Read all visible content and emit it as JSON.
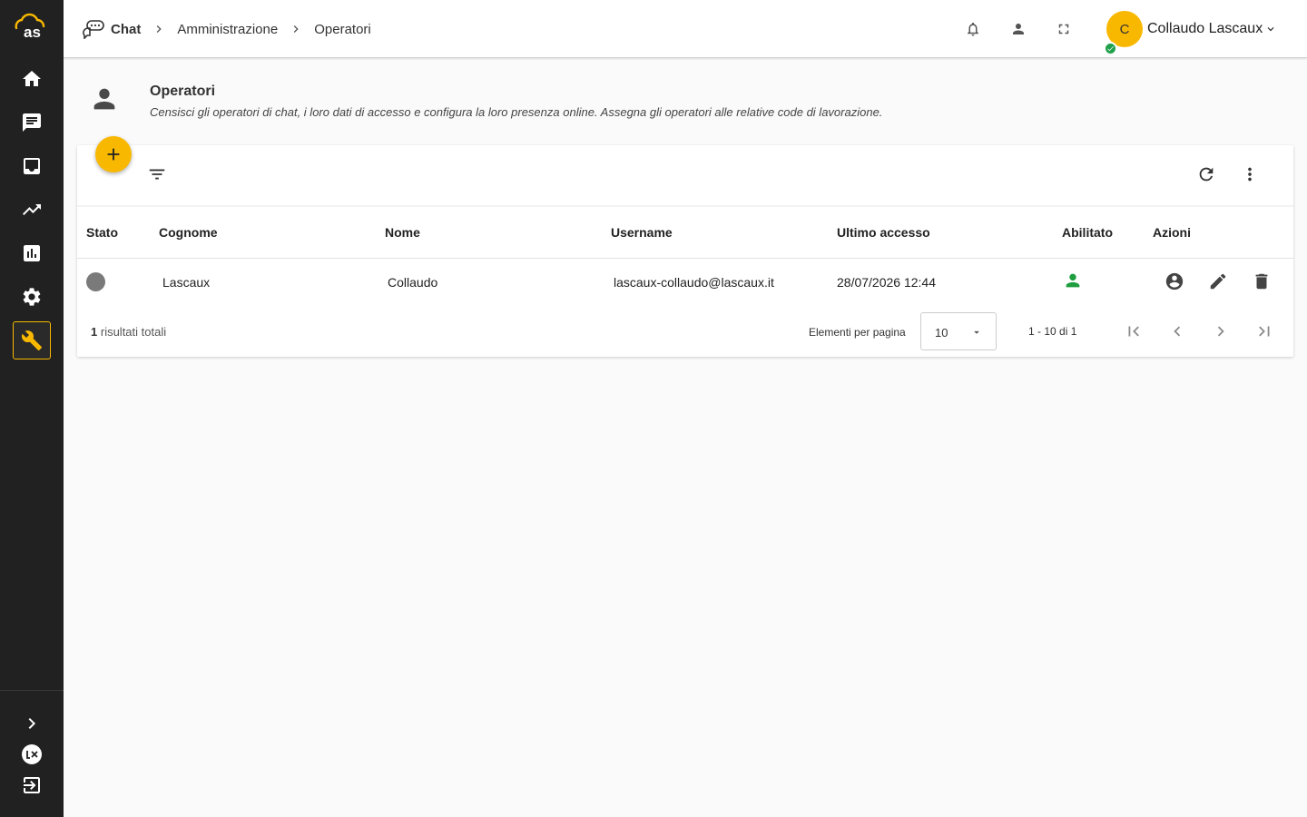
{
  "sidebar": {
    "logo_text": "as",
    "items": [
      {
        "name": "home",
        "icon": "home-icon"
      },
      {
        "name": "chat",
        "icon": "chat-icon"
      },
      {
        "name": "inbox",
        "icon": "inbox-icon"
      },
      {
        "name": "trending",
        "icon": "trending-up-icon"
      },
      {
        "name": "reports",
        "icon": "bar-chart-icon"
      },
      {
        "name": "settings",
        "icon": "gear-icon"
      },
      {
        "name": "admin",
        "icon": "wrench-icon",
        "active": true
      }
    ],
    "bottom": [
      "expand-icon",
      "lx-brand-icon",
      "logout-icon"
    ]
  },
  "header": {
    "breadcrumb": [
      "Chat",
      "Amministrazione",
      "Operatori"
    ],
    "icons": [
      "bell-icon",
      "person-icon",
      "fullscreen-icon"
    ],
    "user": {
      "initial": "C",
      "name": "Collaudo Lascaux",
      "status_color": "#21a04b"
    }
  },
  "page": {
    "title": "Operatori",
    "description": "Censisci gli operatori di chat, i loro dati di accesso e configura la loro presenza online. Assegna gli operatori alle relative code di lavorazione."
  },
  "table": {
    "columns": [
      "Stato",
      "Cognome",
      "Nome",
      "Username",
      "Ultimo accesso",
      "Abilitato",
      "Azioni"
    ],
    "rows": [
      {
        "stato_color": "#7a7a7a",
        "cognome": "Lascaux",
        "nome": "Collaudo",
        "username": "lascaux-collaudo@lascaux.it",
        "ultimo_accesso": "28/07/2026 12:44",
        "abilitato_icon": "person-enabled-icon",
        "azioni": [
          "account-circle-icon",
          "edit-icon",
          "delete-icon"
        ]
      }
    ]
  },
  "footer": {
    "total_count": "1",
    "total_label": "risultati totali",
    "per_page_label": "Elementi per pagina",
    "per_page_value": "10",
    "range": "1 - 10 di 1"
  },
  "colors": {
    "accent": "#f9b800",
    "sidebar_bg": "#212121",
    "enabled": "#1e9e3f"
  }
}
